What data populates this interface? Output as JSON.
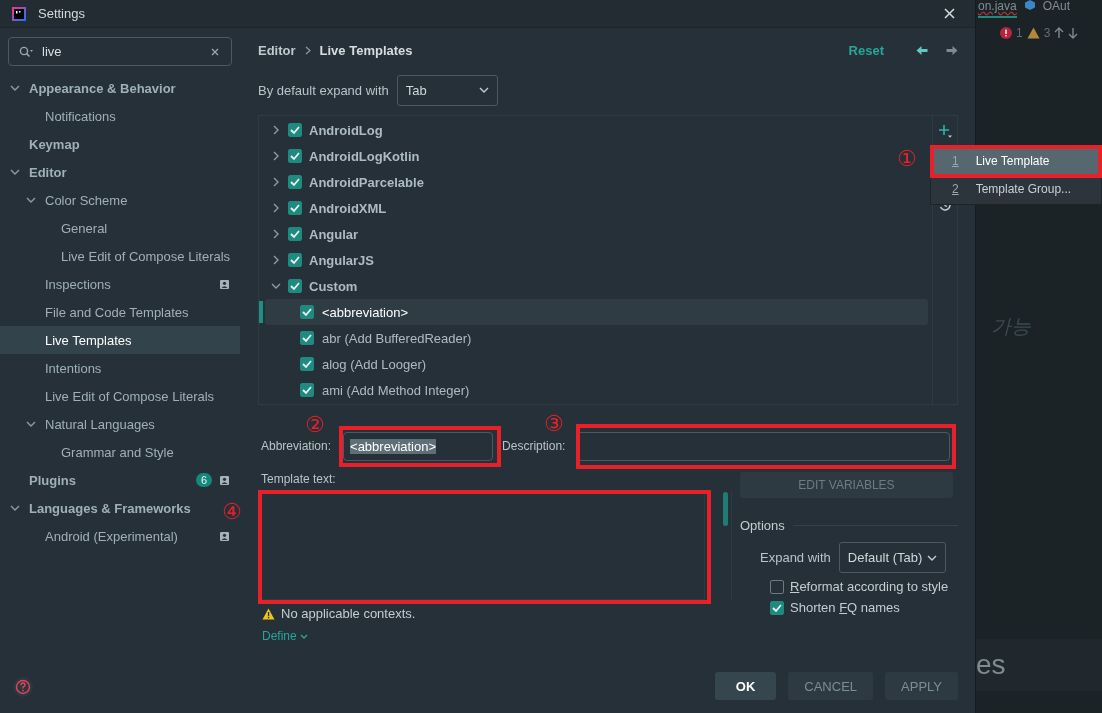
{
  "window": {
    "title": "Settings"
  },
  "search": {
    "value": "live"
  },
  "sidebar": {
    "items": [
      {
        "label": "Appearance & Behavior",
        "expanded": true,
        "selected": false,
        "children": [
          {
            "label": "Notifications",
            "selected": false
          }
        ]
      },
      {
        "label": "Keymap",
        "selected": false
      },
      {
        "label": "Editor",
        "expanded": true,
        "selected": false,
        "children": [
          {
            "label": "Color Scheme",
            "expanded": true,
            "selected": false,
            "children": [
              {
                "label": "General",
                "selected": false
              },
              {
                "label": "Live Edit of Compose Literals",
                "selected": false
              }
            ]
          },
          {
            "label": "Inspections",
            "scoped": true,
            "selected": false
          },
          {
            "label": "File and Code Templates",
            "selected": false
          },
          {
            "label": "Live Templates",
            "selected": true
          },
          {
            "label": "Intentions",
            "selected": false
          },
          {
            "label": "Live Edit of Compose Literals",
            "selected": false
          },
          {
            "label": "Natural Languages",
            "expanded": true,
            "selected": false,
            "children": [
              {
                "label": "Grammar and Style",
                "selected": false
              }
            ]
          }
        ]
      },
      {
        "label": "Plugins",
        "badge": "6",
        "scoped": true,
        "selected": false
      },
      {
        "label": "Languages & Frameworks",
        "expanded": true,
        "selected": false,
        "children": [
          {
            "label": "Android (Experimental)",
            "scoped": true,
            "selected": false
          }
        ]
      }
    ]
  },
  "header": {
    "breadcrumb": [
      "Editor",
      "Live Templates"
    ],
    "reset": "Reset"
  },
  "expand_default": {
    "label": "By default expand with",
    "value": "Tab"
  },
  "templates": [
    {
      "label": "AndroidLog",
      "checked": true,
      "expanded": false,
      "selected": false
    },
    {
      "label": "AndroidLogKotlin",
      "checked": true,
      "expanded": false,
      "selected": false
    },
    {
      "label": "AndroidParcelable",
      "checked": true,
      "expanded": false,
      "selected": false
    },
    {
      "label": "AndroidXML",
      "checked": true,
      "expanded": false,
      "selected": false
    },
    {
      "label": "Angular",
      "checked": true,
      "expanded": false,
      "selected": false
    },
    {
      "label": "AngularJS",
      "checked": true,
      "expanded": false,
      "selected": false
    },
    {
      "label": "Custom",
      "checked": true,
      "expanded": true,
      "selected": false,
      "children": [
        {
          "label": "<abbreviation>",
          "checked": true,
          "selected": true
        },
        {
          "label": "abr (Add BufferedReader)",
          "checked": true,
          "selected": false
        },
        {
          "label": "alog (Add Looger)",
          "checked": true,
          "selected": false
        },
        {
          "label": "ami (Add Method Integer)",
          "checked": true,
          "selected": false
        }
      ]
    }
  ],
  "add_menu": [
    {
      "key": "1",
      "label": "Live Template",
      "selected": true
    },
    {
      "key": "2",
      "label": "Template Group...",
      "selected": false
    }
  ],
  "abbreviation": {
    "label": "Abbreviation:",
    "value": "<abbreviation>",
    "text_selected": true
  },
  "description": {
    "label": "Description:"
  },
  "template_text": {
    "label": "Template text:"
  },
  "edit_variables": {
    "label": "EDIT VARIABLES",
    "disabled": true
  },
  "options": {
    "title": "Options",
    "expand_with": {
      "label": "Expand with",
      "value": "Default (Tab)"
    },
    "checkboxes": [
      {
        "mnemonic": "R",
        "after": "eformat according to style",
        "checked": false
      },
      {
        "before": "Shorten ",
        "mnemonic": "F",
        "after": "Q names",
        "checked": true
      }
    ]
  },
  "warning": "No applicable contexts.",
  "define_link": "Define",
  "buttons": [
    {
      "label": "OK",
      "default": true
    },
    {
      "label": "CANCEL",
      "default": false
    },
    {
      "label": "APPLY",
      "default": false
    }
  ],
  "ide": {
    "tabs": [
      "on.java",
      "OAut"
    ],
    "errors": "1",
    "warnings": "3",
    "hint": "가능",
    "bottom_text": "es"
  },
  "annotations": [
    {
      "label": "①",
      "kind": "menu"
    },
    {
      "label": "②",
      "kind": "abbreviation"
    },
    {
      "label": "③",
      "kind": "description"
    },
    {
      "label": "④",
      "kind": "template"
    }
  ]
}
